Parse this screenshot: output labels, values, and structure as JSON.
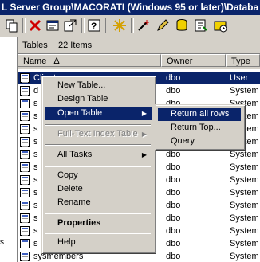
{
  "window": {
    "title": "L Server Group\\MACORATI (Windows 95 or later)\\Databa"
  },
  "toolbar": {
    "icons": [
      "copy-icon",
      "delete-icon",
      "properties-icon",
      "export-icon",
      "help-icon",
      "new-icon",
      "wizard-icon",
      "edit-icon",
      "database-icon",
      "query-icon",
      "schedule-icon"
    ]
  },
  "left_pane": {
    "label": "s"
  },
  "tables_bar": {
    "title": "Tables",
    "count": "22 Items"
  },
  "columns": {
    "name": "Name",
    "sort_indicator": "Δ",
    "owner": "Owner",
    "type": "Type"
  },
  "rows": [
    {
      "name": "Clientes",
      "owner": "dbo",
      "type": "User"
    },
    {
      "name": "d",
      "owner": "dbo",
      "type": "System"
    },
    {
      "name": "s",
      "owner": "dbo",
      "type": "System"
    },
    {
      "name": "s",
      "owner": "dbo",
      "type": "System"
    },
    {
      "name": "s",
      "owner": "dbo",
      "type": "System"
    },
    {
      "name": "s",
      "owner": "dbo",
      "type": "System"
    },
    {
      "name": "s",
      "owner": "dbo",
      "type": "System"
    },
    {
      "name": "s",
      "owner": "dbo",
      "type": "System"
    },
    {
      "name": "s",
      "owner": "dbo",
      "type": "System"
    },
    {
      "name": "s",
      "owner": "dbo",
      "type": "System"
    },
    {
      "name": "s",
      "owner": "dbo",
      "type": "System"
    },
    {
      "name": "s",
      "owner": "dbo",
      "type": "System"
    },
    {
      "name": "s",
      "owner": "dbo",
      "type": "System"
    },
    {
      "name": "s",
      "owner": "dbo",
      "type": "System"
    },
    {
      "name": "sysmembers",
      "owner": "dbo",
      "type": "System"
    }
  ],
  "context_menu": {
    "new_table": "New Table...",
    "design_table": "Design Table",
    "open_table": "Open Table",
    "full_text_index": "Full-Text Index Table",
    "all_tasks": "All Tasks",
    "copy": "Copy",
    "delete": "Delete",
    "rename": "Rename",
    "properties": "Properties",
    "help": "Help"
  },
  "submenu": {
    "return_all_rows": "Return all rows",
    "return_top": "Return Top...",
    "query": "Query"
  },
  "colors": {
    "selection": "#0a246a",
    "face": "#d4d0c8"
  }
}
